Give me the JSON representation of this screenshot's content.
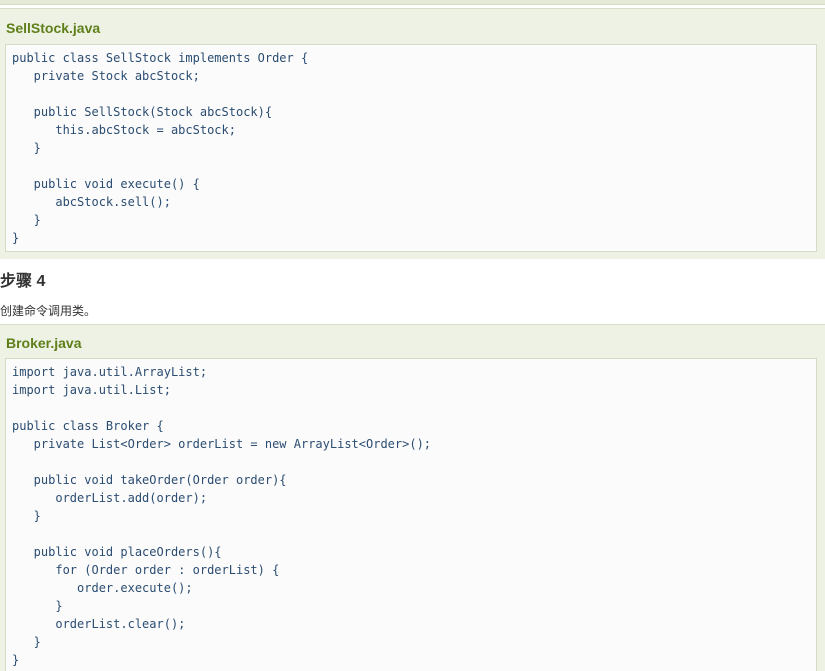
{
  "blocks": [
    {
      "filename": "SellStock.java",
      "code": [
        "public class SellStock implements Order {",
        "   private Stock abcStock;",
        "",
        "   public SellStock(Stock abcStock){",
        "      this.abcStock = abcStock;",
        "   }",
        "",
        "   public void execute() {",
        "      abcStock.sell();",
        "   }",
        "}"
      ]
    },
    {
      "filename": "Broker.java",
      "code": [
        "import java.util.ArrayList;",
        "import java.util.List;",
        "",
        "public class Broker {",
        "   private List<Order> orderList = new ArrayList<Order>();",
        "",
        "   public void takeOrder(Order order){",
        "      orderList.add(order);",
        "   }",
        "",
        "   public void placeOrders(){",
        "      for (Order order : orderList) {",
        "         order.execute();",
        "      }",
        "      orderList.clear();",
        "   }",
        "}"
      ]
    }
  ],
  "step": {
    "heading": "步骤 4",
    "description": "创建命令调用类。"
  },
  "colors": {
    "filename": "#5f7f1a",
    "code_text": "#2b4d72",
    "block_bg": "#eef2e4",
    "code_bg": "#fbfbfb"
  }
}
